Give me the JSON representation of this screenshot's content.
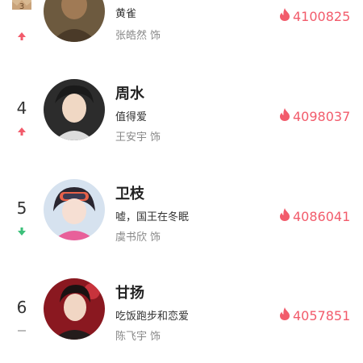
{
  "colors": {
    "heat": "#f25b6b",
    "up": "#f25b6b",
    "down": "#3cc07a",
    "flat": "#bbbbbb",
    "crown": "#c9a37a"
  },
  "icons": {
    "heat": "flame-icon",
    "up": "arrow-up-icon",
    "down": "arrow-down-icon",
    "flat": "dash-icon",
    "crown": "crown-badge-icon"
  },
  "suffix": "饰",
  "rows": [
    {
      "rank": "3",
      "trend": "up",
      "name": "",
      "role": "黄雀",
      "actor": "张皓然",
      "heat": "4100825"
    },
    {
      "rank": "4",
      "trend": "up",
      "name": "周水",
      "role": "值得爱",
      "actor": "王安宇",
      "heat": "4098037"
    },
    {
      "rank": "5",
      "trend": "down",
      "name": "卫枝",
      "role": "嘘，国王在冬眠",
      "actor": "虞书欣",
      "heat": "4086041"
    },
    {
      "rank": "6",
      "trend": "flat",
      "name": "甘扬",
      "role": "吃饭跑步和恋爱",
      "actor": "陈飞宇",
      "heat": "4057851"
    }
  ]
}
